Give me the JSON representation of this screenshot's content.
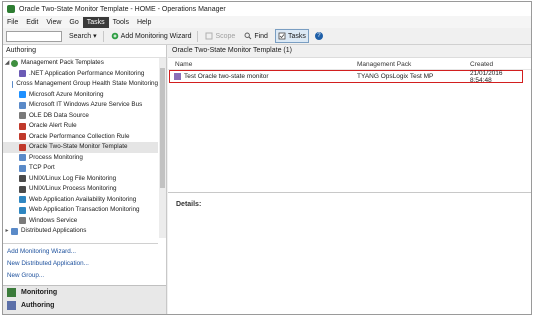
{
  "window": {
    "title": "Oracle Two-State Monitor Template - HOME - Operations Manager"
  },
  "menu": {
    "items": [
      "File",
      "Edit",
      "View",
      "Go",
      "Tasks",
      "Tools",
      "Help"
    ],
    "active": "Tasks"
  },
  "toolbar": {
    "search_placeholder": "",
    "search_label": "Search",
    "add_wizard": "Add Monitoring Wizard",
    "scope": "Scope",
    "find": "Find",
    "tasks": "Tasks"
  },
  "left": {
    "header": "Authoring",
    "root": "Management Pack Templates",
    "items": [
      ".NET Application Performance Monitoring",
      "Cross Management Group Health State Monitoring",
      "Microsoft Azure Monitoring",
      "Microsoft IT Windows Azure Service Bus",
      "OLE DB Data Source",
      "Oracle Alert Rule",
      "Oracle Performance Collection Rule",
      "Oracle Two-State Monitor Template",
      "Process Monitoring",
      "TCP Port",
      "UNIX/Linux Log File Monitoring",
      "UNIX/Linux Process Monitoring",
      "Web Application Availability Monitoring",
      "Web Application Transaction Monitoring",
      "Windows Service"
    ],
    "extra": "Distributed Applications",
    "actions": [
      "Add Monitoring Wizard...",
      "New Distributed Application...",
      "New Group..."
    ],
    "wunderbar": [
      "Monitoring",
      "Authoring"
    ]
  },
  "right": {
    "header": "Oracle Two-State Monitor Template (1)",
    "columns": {
      "name": "Name",
      "mp": "Management Pack",
      "created": "Created"
    },
    "row": {
      "name": "Test Oracle two-state monitor",
      "mp": "TYANG OpsLogix Test MP",
      "created": "21/01/2016 8:54:48"
    },
    "details_label": "Details:"
  },
  "colors": {
    "accent_red": "#d21f1f",
    "link_blue": "#1b4f9c"
  }
}
